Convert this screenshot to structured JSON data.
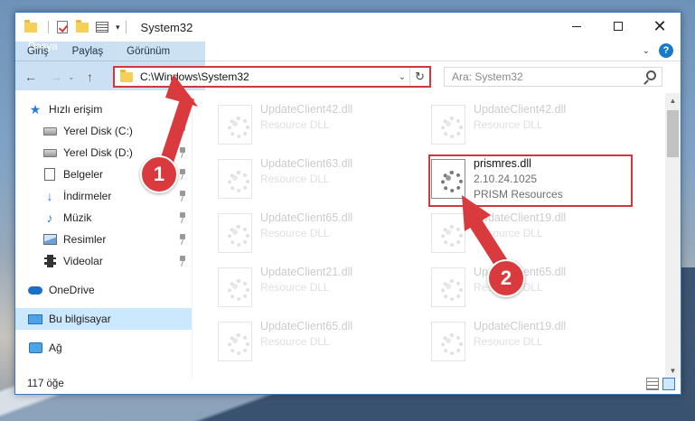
{
  "window": {
    "title": "System32",
    "status_count": "117 öğe"
  },
  "ribbon": {
    "tabs": [
      "Dosya",
      "Giriş",
      "Paylaş",
      "Görünüm"
    ]
  },
  "nav": {
    "address": "C:\\Windows\\System32",
    "search_placeholder": "Ara: System32"
  },
  "sidebar": {
    "items": [
      {
        "label": "Hızlı erişim",
        "icon": "star-icon"
      },
      {
        "label": "Yerel Disk (C:)",
        "icon": "drive-icon",
        "pinned": true
      },
      {
        "label": "Yerel Disk (D:)",
        "icon": "drive-icon",
        "pinned": true
      },
      {
        "label": "Belgeler",
        "icon": "document-icon",
        "pinned": true
      },
      {
        "label": "İndirmeler",
        "icon": "download-icon",
        "pinned": true
      },
      {
        "label": "Müzik",
        "icon": "music-icon",
        "pinned": true
      },
      {
        "label": "Resimler",
        "icon": "pictures-icon",
        "pinned": true
      },
      {
        "label": "Videolar",
        "icon": "videos-icon",
        "pinned": true
      },
      {
        "label": "OneDrive",
        "icon": "cloud-icon"
      },
      {
        "label": "Bu bilgisayar",
        "icon": "computer-icon",
        "selected": true
      },
      {
        "label": "Ağ",
        "icon": "network-icon"
      }
    ]
  },
  "files": [
    {
      "name": "UpdateClient42.dll",
      "desc": "Resource DLL"
    },
    {
      "name": "UpdateClient42.dll",
      "desc": "Resource DLL"
    },
    {
      "name": "UpdateClient63.dll",
      "desc": "Resource DLL"
    },
    {
      "name": "prismres.dll",
      "version": "2.10.24.1025",
      "desc": "PRISM Resources",
      "highlighted": true
    },
    {
      "name": "UpdateClient65.dll",
      "desc": "Resource DLL"
    },
    {
      "name": "UpdateClient19.dll",
      "desc": "Resource DLL"
    },
    {
      "name": "UpdateClient21.dll",
      "desc": "Resource DLL"
    },
    {
      "name": "UpdateClient65.dll",
      "desc": "Resource DLL"
    },
    {
      "name": "UpdateClient65.dll",
      "desc": "Resource DLL"
    },
    {
      "name": "UpdateClient19.dll",
      "desc": "Resource DLL"
    }
  ],
  "annotations": {
    "step1": "1",
    "step2": "2",
    "color": "#d93a3e"
  }
}
